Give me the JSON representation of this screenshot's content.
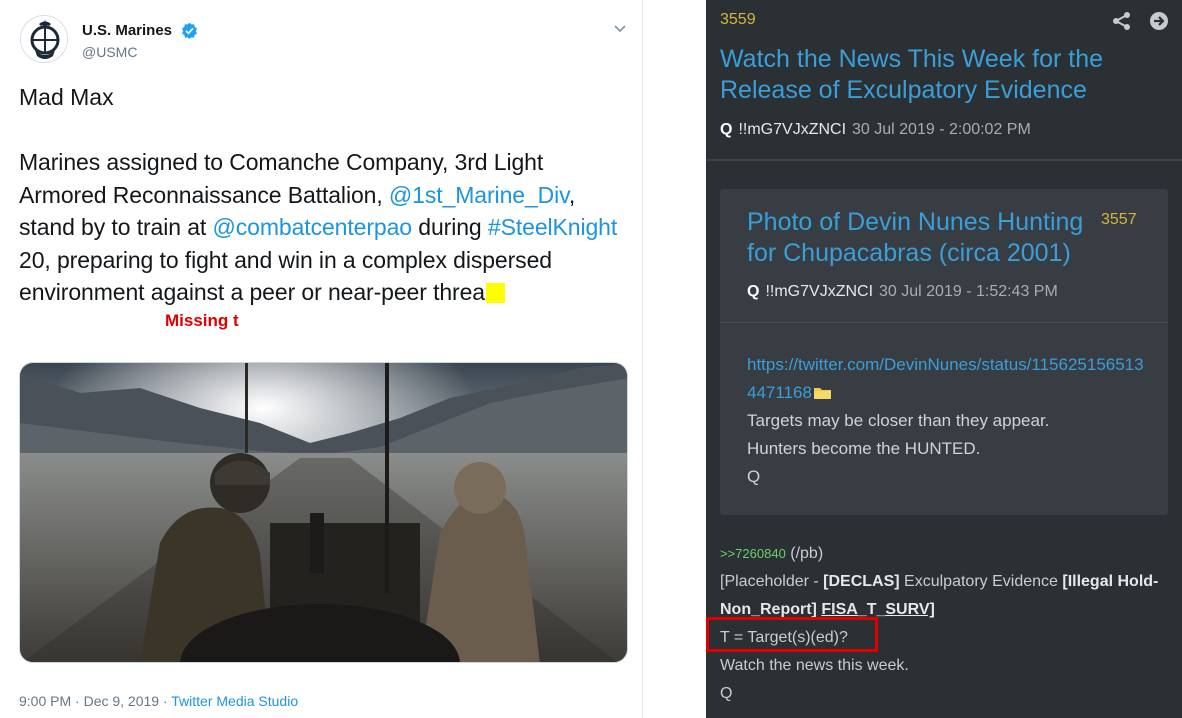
{
  "tweet": {
    "display_name": "U.S. Marines",
    "handle": "@USMC",
    "title": "Mad Max",
    "body_1": "Marines assigned to Comanche Company, 3rd Light Armored Reconnaissance Battalion, ",
    "mention_1": "@1st_Marine_Div",
    "body_2": ", stand by to train at ",
    "mention_2": "@combatcenterpao",
    "body_3": " during ",
    "hashtag": "#SteelKnight",
    "body_4": " 20, preparing to fight and win in a complex dispersed environment against a peer or near-peer threa",
    "annotation": "Missing t",
    "timestamp": "9:00 PM · Dec 9, 2019 · ",
    "source": "Twitter Media Studio",
    "icons": [
      "marines-emblem-icon",
      "verified-icon",
      "chevron-down-icon"
    ],
    "colors": {
      "link": "#1b95e0",
      "highlight": "#ffff00",
      "annotation": "#e00000"
    }
  },
  "qpost": {
    "number": "3559",
    "title": "Watch the News This Week for the Release of Exculpatory Evidence",
    "author": "Q",
    "tripcode": "!!mG7VJxZNCI",
    "date": "30 Jul 2019 - 2:00:02 PM",
    "icons": [
      "share-icon",
      "arrow-right-circle-icon",
      "folder-icon"
    ],
    "quoted": {
      "title": "Photo of Devin Nunes Hunting for Chupacabras (circa 2001)",
      "number": "3557",
      "author": "Q",
      "tripcode": "!!mG7VJxZNCI",
      "date": "30 Jul 2019 - 1:52:43 PM",
      "link": "https://twitter.com/DevinNunes/status/1156251565134471168",
      "lines": [
        "Targets may be closer than they appear.",
        "Hunters become the HUNTED.",
        "Q"
      ]
    },
    "reply": {
      "ref": ">>7260840",
      "ref_suffix": " (/pb)",
      "p1": "[Placeholder - ",
      "declas": "[DECLAS]",
      "p2": " Exculpatory Evidence ",
      "illegal": "[Illegal Hold-Non_Report]",
      "fisa_a": "FISA",
      "fisa_b": "_T_",
      "fisa_c": "SURV]",
      "line2": "T = Target(s)(ed)?",
      "line3": "Watch the news this week.",
      "line4": "Q"
    },
    "colors": {
      "background": "#2b3034",
      "title": "#3a9fd8",
      "number": "#d4b63a",
      "ref": "#6fcf6f",
      "highlight_box": "#e00000"
    }
  }
}
